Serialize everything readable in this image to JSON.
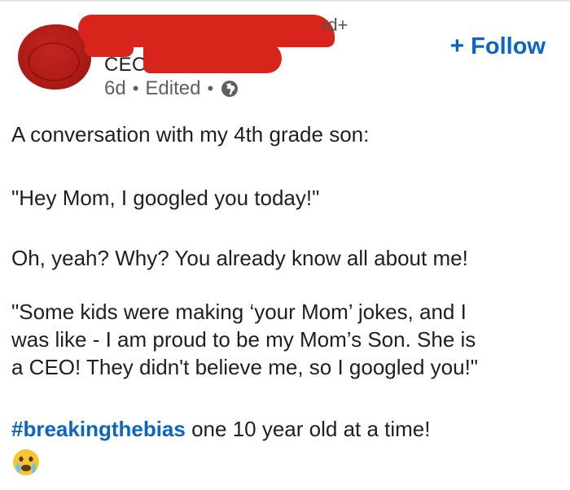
{
  "header": {
    "suffix": "rd+",
    "title": "CEO",
    "age": "6d",
    "separator": "•",
    "edited": "Edited",
    "follow_label": "Follow",
    "follow_plus": "+"
  },
  "post": {
    "line1": "A conversation with my 4th grade son:",
    "line2": "\"Hey Mom, I googled you today!\"",
    "line3": "Oh, yeah? Why? You already know all about me!",
    "line4a": "\"Some kids were making ‘your Mom’ jokes, and I",
    "line4b": "was like - I am proud to be my Mom’s Son. She is",
    "line4c": "a CEO! They didn't believe me, so I googled you!\"",
    "hashtag": "#breakingthebias",
    "tail": "one 10 year old at a time!"
  },
  "colors": {
    "accent": "#0a66c2",
    "redaction": "#d8251c"
  },
  "icons": [
    "globe-icon",
    "crying-face-emoji-icon"
  ]
}
